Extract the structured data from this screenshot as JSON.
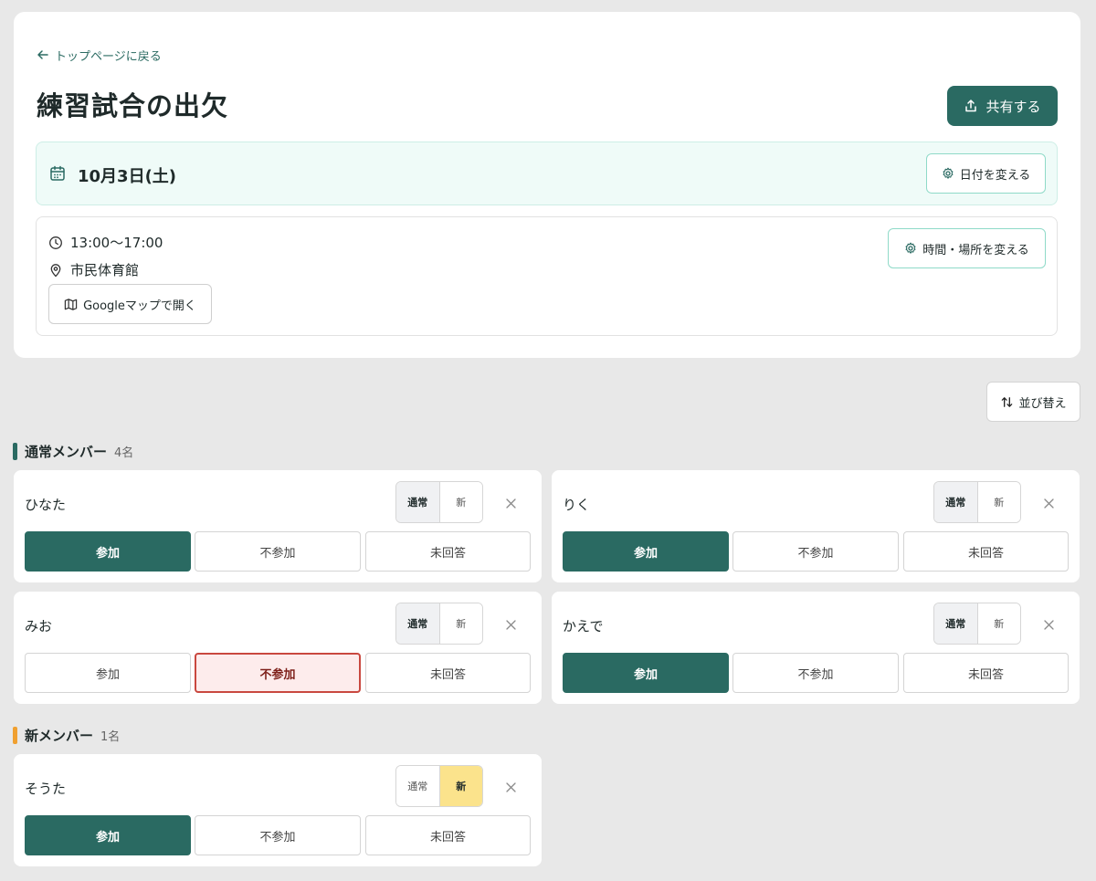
{
  "header": {
    "back_label": "トップページに戻る",
    "title": "練習試合の出欠",
    "share_label": "共有する"
  },
  "event": {
    "date": "10月3日(土)",
    "change_date_label": "日付を変える",
    "time": "13:00〜17:00",
    "place": "市民体育館",
    "change_place_label": "時間・場所を変える",
    "map_label": "Googleマップで開く"
  },
  "toolbar": {
    "sort_label": "並び替え"
  },
  "labels": {
    "regular": "通常",
    "new": "新",
    "attend": "参加",
    "absent": "不参加",
    "noanswer": "未回答"
  },
  "sections": {
    "regular": {
      "title": "通常メンバー",
      "count": "4名",
      "color": "#2a6a62"
    },
    "new": {
      "title": "新メンバー",
      "count": "1名",
      "color": "#f0a030"
    }
  },
  "members": [
    {
      "name": "ひなた",
      "type": "regular",
      "status": "attend"
    },
    {
      "name": "りく",
      "type": "regular",
      "status": "attend"
    },
    {
      "name": "みお",
      "type": "regular",
      "status": "absent"
    },
    {
      "name": "かえで",
      "type": "regular",
      "status": "attend"
    },
    {
      "name": "そうた",
      "type": "new",
      "status": "attend"
    }
  ],
  "colors": {
    "primary": "#2a6a62",
    "date_panel_bg": "#effbf8",
    "absent_border": "#c9483f",
    "new_highlight": "#fbe38c"
  }
}
